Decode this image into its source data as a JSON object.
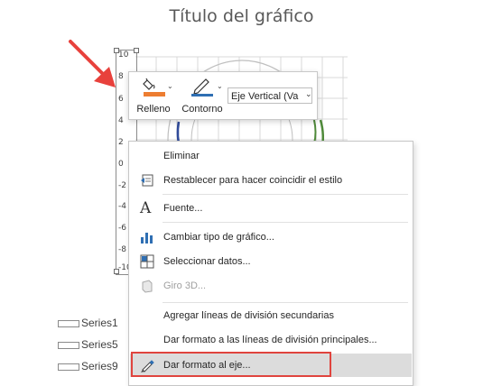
{
  "chart": {
    "title": "Título del gráfico",
    "y_ticks": [
      "10",
      "8",
      "6",
      "4",
      "2",
      "0",
      "-2",
      "-4",
      "-6",
      "-8",
      "-10"
    ],
    "legend": [
      "Series1",
      "Series5",
      "Series9"
    ],
    "series_colors": [
      "#2f4a9a",
      "#4f8a3a"
    ]
  },
  "mini_toolbar": {
    "fill_label": "Relleno",
    "outline_label": "Contorno",
    "element_select": "Eje Vertical (Va",
    "fill_color": "#ed7d31"
  },
  "context_menu": {
    "items": [
      {
        "label": "Eliminar",
        "icon": "none",
        "enabled": true
      },
      {
        "label": "Restablecer para hacer coincidir el estilo",
        "icon": "reset-style-icon",
        "enabled": true
      },
      {
        "label": "Fuente...",
        "icon": "font-icon",
        "enabled": true
      },
      {
        "label": "Cambiar tipo de gráfico...",
        "icon": "chart-type-icon",
        "enabled": true
      },
      {
        "label": "Seleccionar datos...",
        "icon": "select-data-icon",
        "enabled": true
      },
      {
        "label": "Giro 3D...",
        "icon": "rotate-3d-icon",
        "enabled": false
      },
      {
        "label": "Agregar líneas de división secundarias",
        "icon": "none",
        "enabled": true
      },
      {
        "label": "Dar formato a las líneas de división principales...",
        "icon": "none",
        "enabled": true
      },
      {
        "label": "Dar formato al eje...",
        "icon": "format-axis-icon",
        "enabled": true
      }
    ]
  },
  "annotation": {
    "arrow_color": "#e8413c",
    "highlight_color": "#e0443e"
  }
}
